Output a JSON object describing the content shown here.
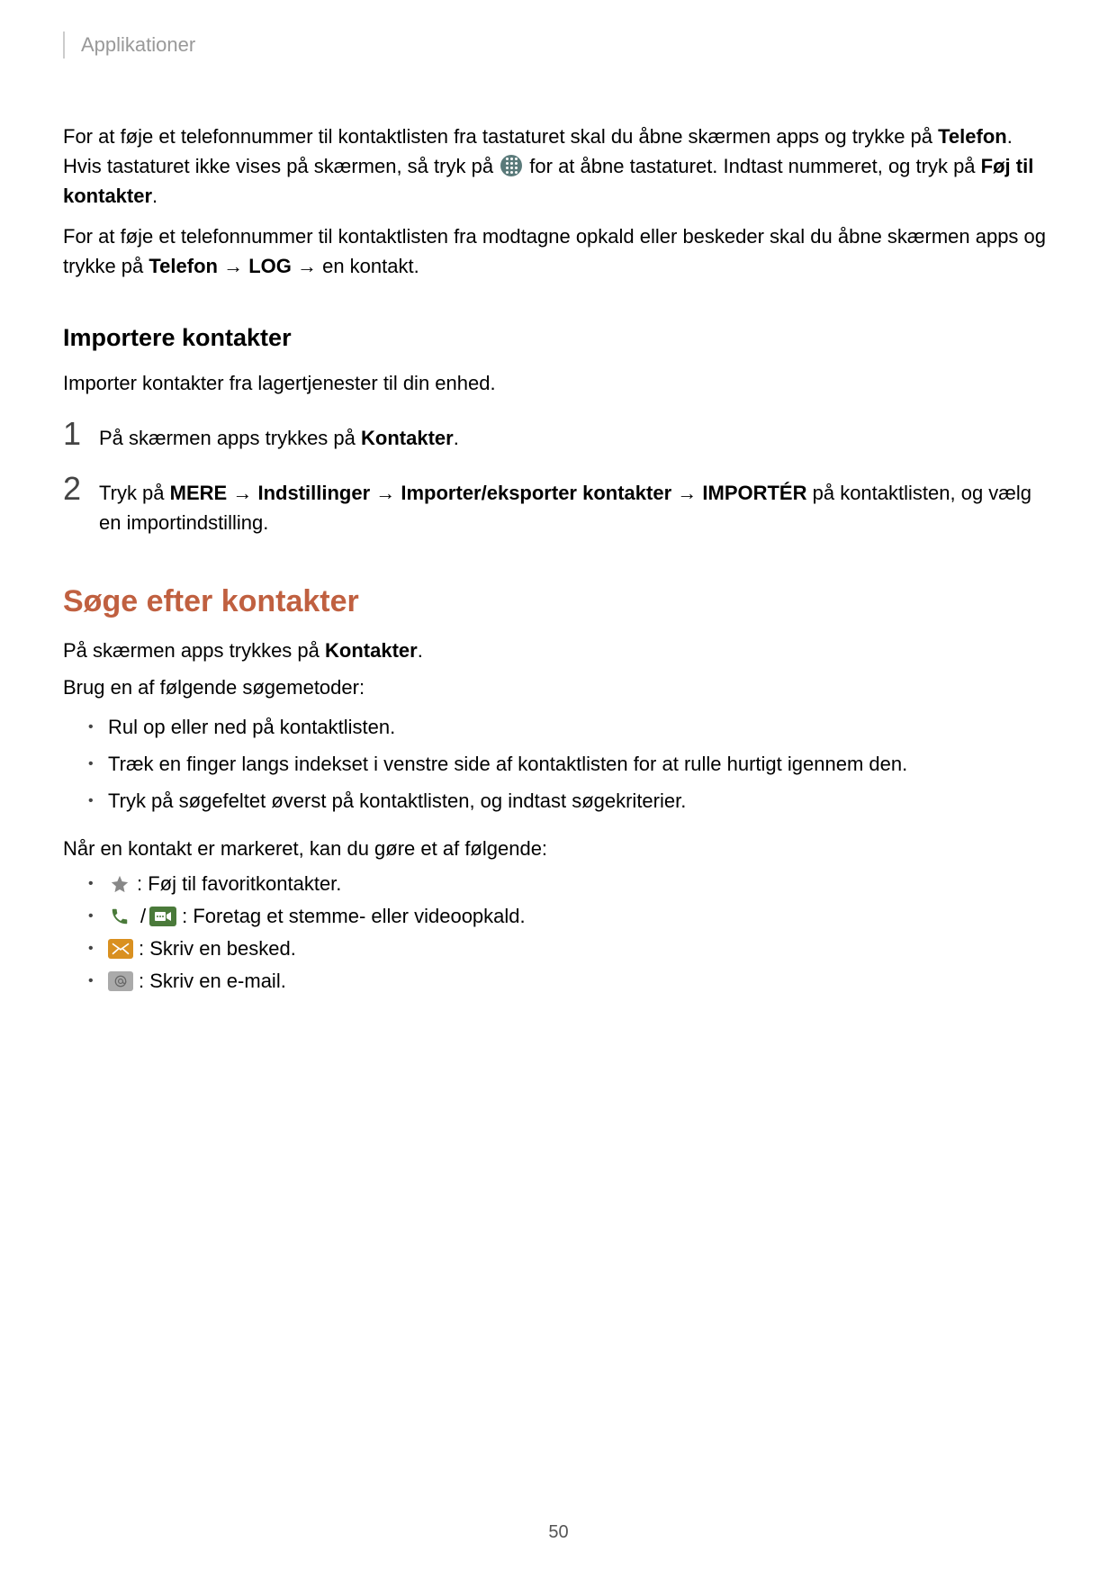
{
  "header": {
    "breadcrumb": "Applikationer"
  },
  "intro": {
    "p1a": "For at føje et telefonnummer til kontaktlisten fra tastaturet skal du åbne skærmen apps og trykke på ",
    "p1b": "Telefon",
    "p1c": ". Hvis tastaturet ikke vises på skærmen, så tryk på ",
    "p1d": " for at åbne tastaturet. Indtast nummeret, og tryk på ",
    "p1e": "Føj til kontakter",
    "p1f": ".",
    "p2a": "For at føje et telefonnummer til kontaktlisten fra modtagne opkald eller beskeder skal du åbne skærmen apps og trykke på ",
    "p2b": "Telefon",
    "arrow": " → ",
    "p2c": "LOG",
    "p2d": " → en kontakt."
  },
  "import": {
    "heading": "Importere kontakter",
    "intro": "Importer kontakter fra lagertjenester til din enhed.",
    "step1": {
      "num": "1",
      "a": "På skærmen apps trykkes på ",
      "b": "Kontakter",
      "c": "."
    },
    "step2": {
      "num": "2",
      "a": "Tryk på ",
      "b": "MERE",
      "c": "Indstillinger",
      "d": "Importer/eksporter kontakter",
      "e": "IMPORTÉR",
      "f": " på kontaktlisten, og vælg en importindstilling."
    }
  },
  "search": {
    "heading": "Søge efter kontakter",
    "p1a": "På skærmen apps trykkes på ",
    "p1b": "Kontakter",
    "p1c": ".",
    "p2": "Brug en af følgende søgemetoder:",
    "bullets": {
      "b1": "Rul op eller ned på kontaktlisten.",
      "b2": "Træk en finger langs indekset i venstre side af kontaktlisten for at rulle hurtigt igennem den.",
      "b3": "Tryk på søgefeltet øverst på kontaktlisten, og indtast søgekriterier."
    },
    "p3": "Når en kontakt er markeret, kan du gøre et af følgende:",
    "actions": {
      "fav": " : Føj til favoritkontakter.",
      "call": " : Foretag et stemme- eller videoopkald.",
      "msg": " : Skriv en besked.",
      "email": " : Skriv en e-mail.",
      "slash": " / "
    }
  },
  "page_number": "50"
}
